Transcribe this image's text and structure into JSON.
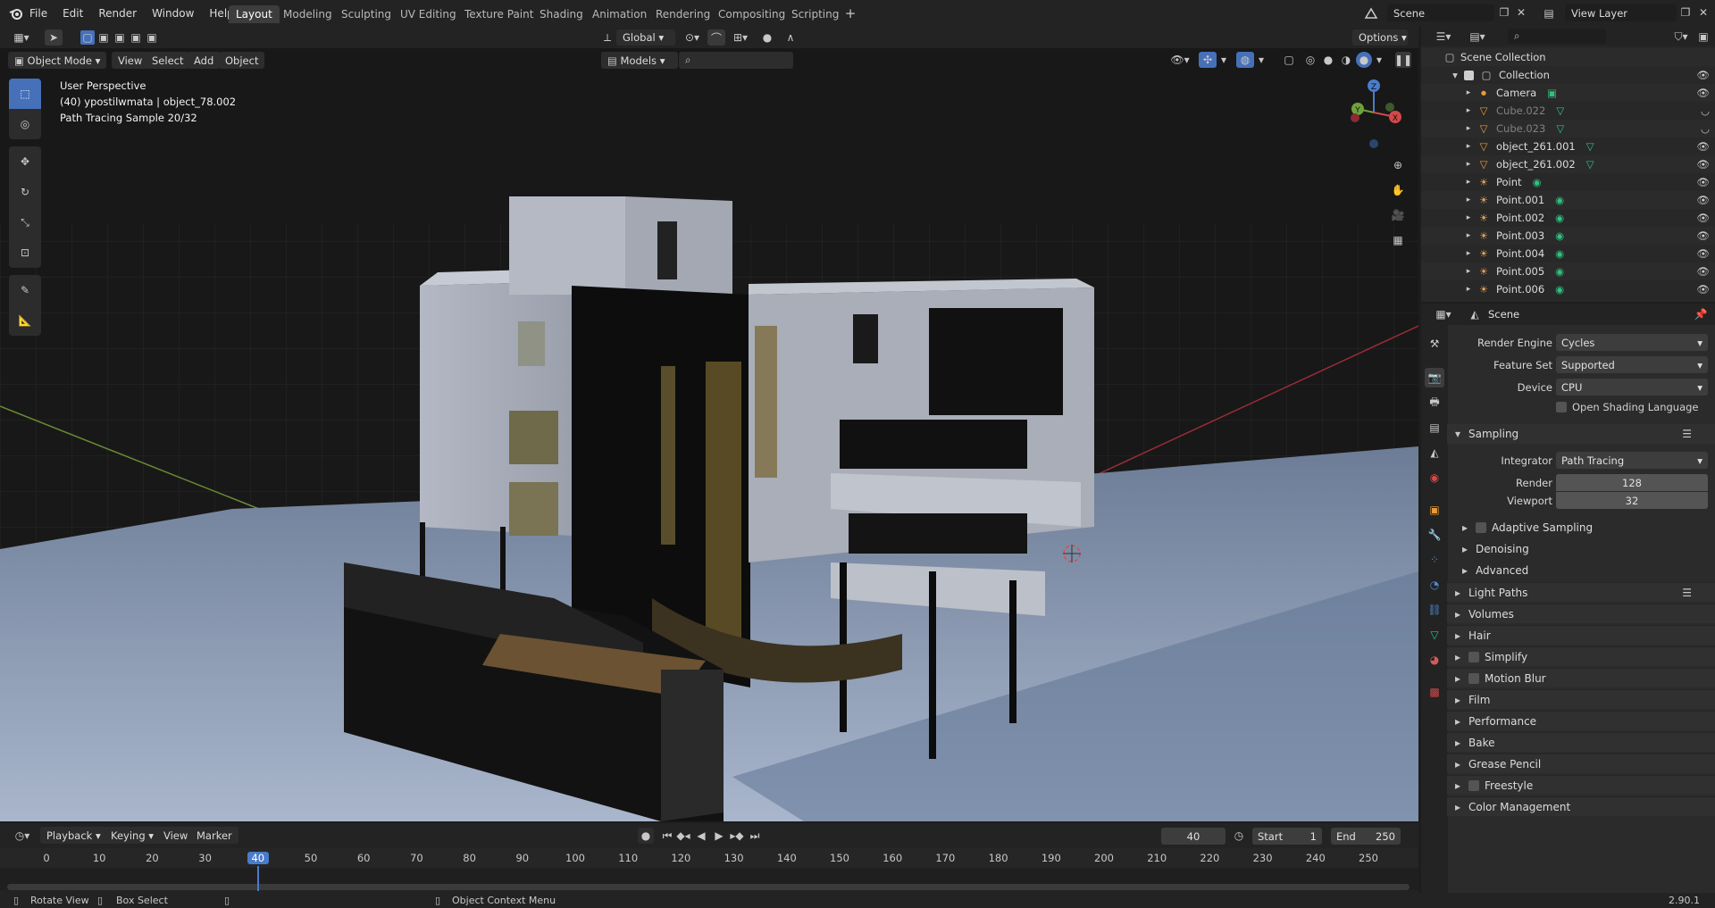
{
  "menus": [
    "File",
    "Edit",
    "Render",
    "Window",
    "Help"
  ],
  "workspaces": [
    "Layout",
    "Modeling",
    "Sculpting",
    "UV Editing",
    "Texture Paint",
    "Shading",
    "Animation",
    "Rendering",
    "Compositing",
    "Scripting"
  ],
  "scene": {
    "name": "Scene",
    "view_layer": "View Layer"
  },
  "viewport": {
    "mode": "Object Mode",
    "menu": [
      "View",
      "Select",
      "Add",
      "Object"
    ],
    "orientation": "Global",
    "options": "Options",
    "collection_selector": "Models",
    "overlay_lines": [
      "User Perspective",
      "(40) ypostilwmata | object_78.002",
      "Path Tracing Sample 20/32"
    ],
    "axes": {
      "x": "X",
      "y": "Y",
      "z": "Z"
    }
  },
  "outliner": {
    "root": "Scene Collection",
    "collection": "Collection",
    "items": [
      {
        "name": "Camera",
        "type": "camera",
        "dim": false
      },
      {
        "name": "Cube.022",
        "type": "mesh",
        "dim": true
      },
      {
        "name": "Cube.023",
        "type": "mesh",
        "dim": true
      },
      {
        "name": "object_261.001",
        "type": "mesh",
        "dim": false
      },
      {
        "name": "object_261.002",
        "type": "mesh",
        "dim": false
      },
      {
        "name": "Point",
        "type": "light",
        "dim": false
      },
      {
        "name": "Point.001",
        "type": "light",
        "dim": false
      },
      {
        "name": "Point.002",
        "type": "light",
        "dim": false
      },
      {
        "name": "Point.003",
        "type": "light",
        "dim": false
      },
      {
        "name": "Point.004",
        "type": "light",
        "dim": false
      },
      {
        "name": "Point.005",
        "type": "light",
        "dim": false
      },
      {
        "name": "Point.006",
        "type": "light",
        "dim": false
      }
    ]
  },
  "properties": {
    "context": "Scene",
    "render_engine": {
      "label": "Render Engine",
      "value": "Cycles"
    },
    "feature_set": {
      "label": "Feature Set",
      "value": "Supported"
    },
    "device": {
      "label": "Device",
      "value": "CPU"
    },
    "osl": "Open Shading Language",
    "sampling": {
      "title": "Sampling",
      "integrator": {
        "label": "Integrator",
        "value": "Path Tracing"
      },
      "render": {
        "label": "Render",
        "value": "128"
      },
      "viewport": {
        "label": "Viewport",
        "value": "32"
      },
      "subpanels": [
        "Adaptive Sampling",
        "Denoising",
        "Advanced"
      ]
    },
    "panels": [
      {
        "name": "Light Paths",
        "checkbox": false
      },
      {
        "name": "Volumes",
        "checkbox": false
      },
      {
        "name": "Hair",
        "checkbox": false
      },
      {
        "name": "Simplify",
        "checkbox": true
      },
      {
        "name": "Motion Blur",
        "checkbox": true
      },
      {
        "name": "Film",
        "checkbox": false
      },
      {
        "name": "Performance",
        "checkbox": false
      },
      {
        "name": "Bake",
        "checkbox": false
      },
      {
        "name": "Grease Pencil",
        "checkbox": false
      },
      {
        "name": "Freestyle",
        "checkbox": true
      },
      {
        "name": "Color Management",
        "checkbox": false
      }
    ]
  },
  "timeline": {
    "menus": [
      "Playback",
      "Keying",
      "View",
      "Marker"
    ],
    "current": "40",
    "start_label": "Start",
    "start": "1",
    "end_label": "End",
    "end": "250",
    "ticks": [
      "0",
      "10",
      "20",
      "30",
      "40",
      "50",
      "60",
      "70",
      "80",
      "90",
      "100",
      "110",
      "120",
      "130",
      "140",
      "150",
      "160",
      "170",
      "180",
      "190",
      "200",
      "210",
      "220",
      "230",
      "240",
      "250"
    ]
  },
  "status": {
    "left": "Rotate View",
    "middle": "Box Select",
    "context": "Object Context Menu",
    "version": "2.90.1"
  },
  "colors": {
    "accent": "#4670b8",
    "frame": "#4a7cc9",
    "mesh": "#e89a3c",
    "light": "#e8a25a",
    "green": "#2ec27e"
  }
}
